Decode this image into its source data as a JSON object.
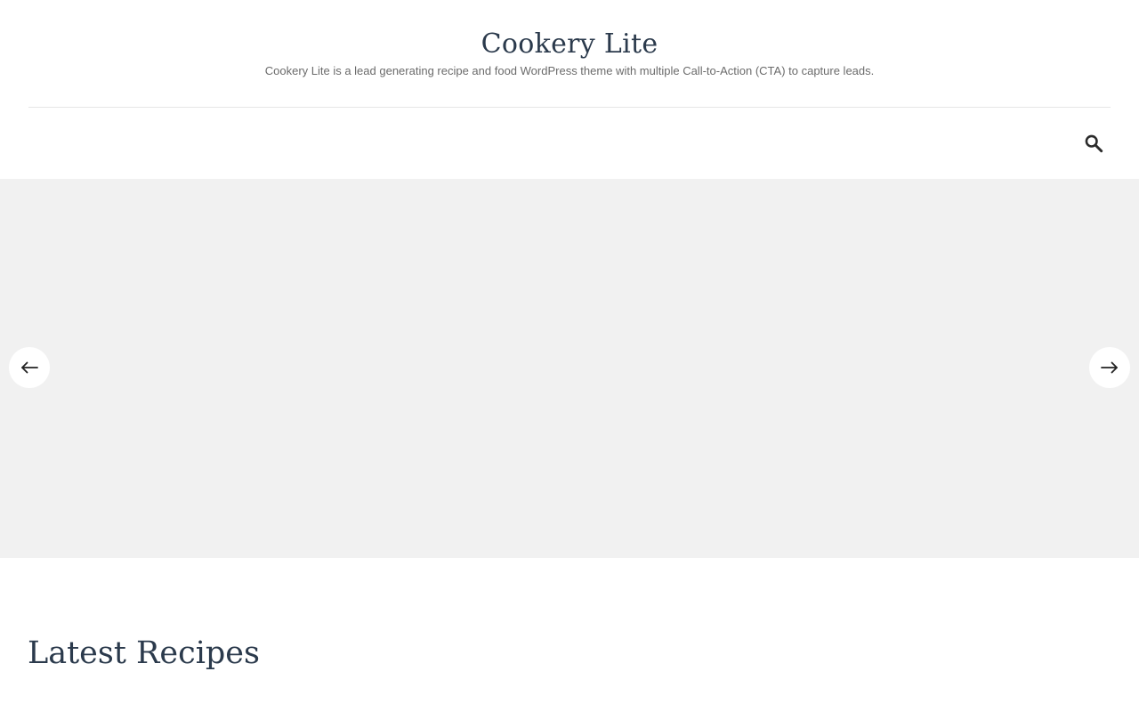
{
  "header": {
    "site_title": "Cookery Lite",
    "site_description": "Cookery Lite is a lead generating recipe and food WordPress theme with multiple Call-to-Action (CTA) to capture leads."
  },
  "nav": {
    "search_icon": "search-icon"
  },
  "slider": {
    "prev_icon": "arrow-left-icon",
    "next_icon": "arrow-right-icon"
  },
  "sections": {
    "latest_heading": "Latest Recipes"
  },
  "colors": {
    "title": "#2b3a4c",
    "description": "#6b6b6b",
    "slider_background": "#f1f1f1",
    "divider": "#e6e6e6"
  }
}
